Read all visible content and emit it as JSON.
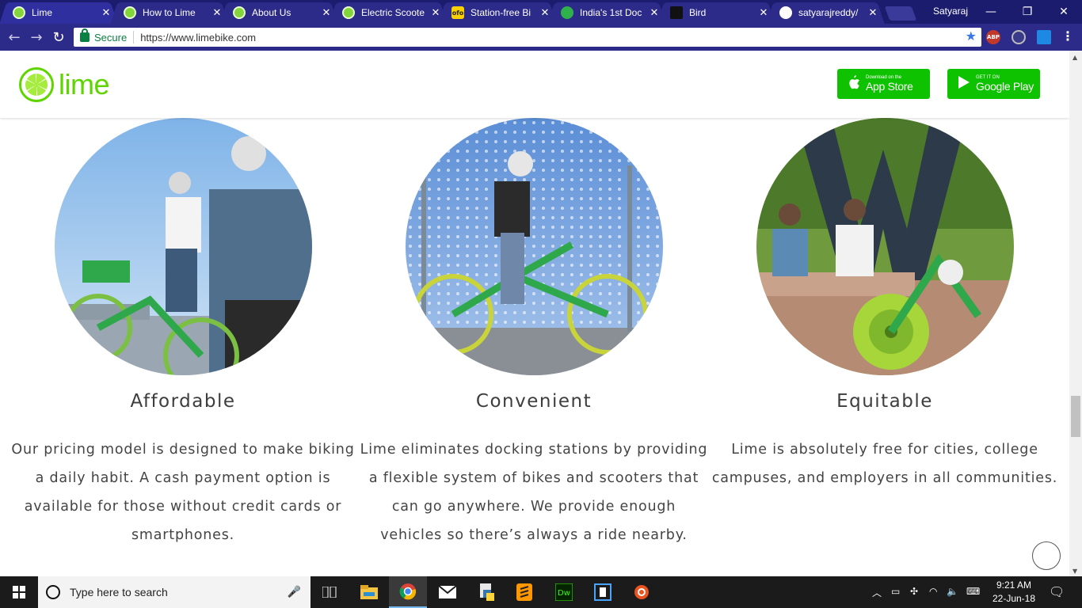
{
  "browser": {
    "tabs": [
      {
        "title": "Lime",
        "favicon": "lime-icon",
        "active": true
      },
      {
        "title": "How to Lime",
        "favicon": "lime-icon"
      },
      {
        "title": "About Us",
        "favicon": "lime-icon"
      },
      {
        "title": "Electric Scoote",
        "favicon": "lime-icon"
      },
      {
        "title": "Station-free Bi",
        "favicon": "ofo-icon",
        "favicon_text": "ofo"
      },
      {
        "title": "India's 1st Doc",
        "favicon": "bike-icon"
      },
      {
        "title": "Bird",
        "favicon": "bird-icon"
      },
      {
        "title": "satyarajreddy/",
        "favicon": "github-icon"
      }
    ],
    "user": "Satyaraj",
    "secure_label": "Secure",
    "url": "https://www.limebike.com",
    "extensions": [
      "ABP"
    ]
  },
  "site": {
    "brand": "lime",
    "brand_color": "#5fd500",
    "app_store": {
      "small": "Download on the",
      "big": "App Store"
    },
    "google_play": {
      "small": "GET IT ON",
      "big": "Google Play"
    },
    "button_color": "#0fc200"
  },
  "features": [
    {
      "title": "Affordable",
      "text": "Our pricing model is designed to make biking a daily habit. A cash payment option is available for those without credit cards or smartphones."
    },
    {
      "title": "Convenient",
      "text": "Lime eliminates docking stations by providing a flexible system of bikes and scooters that can go anywhere. We provide enough vehicles so there’s always a ride nearby."
    },
    {
      "title": "Equitable",
      "text": "Lime is absolutely free for cities, college campuses, and employers in all communities."
    }
  ],
  "taskbar": {
    "search_placeholder": "Type here to search",
    "time": "9:21 AM",
    "date": "22-Jun-18"
  }
}
